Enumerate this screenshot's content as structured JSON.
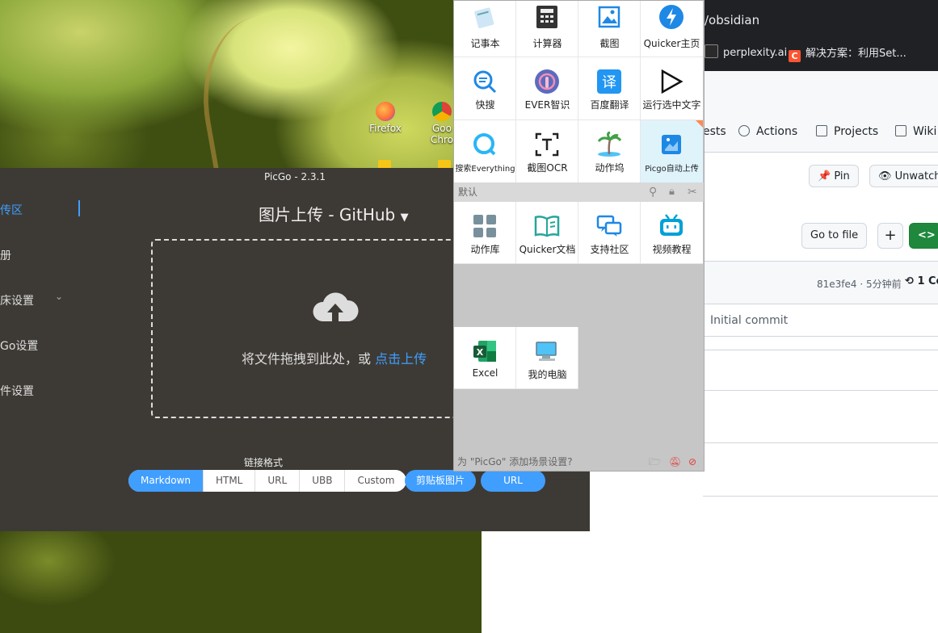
{
  "desktop": {
    "icons": [
      {
        "label": "Firefox",
        "color": "#ff7139"
      },
      {
        "label": "Goo\nChro",
        "label_line1": "Goo",
        "label_line2": "Chro",
        "color": "#4285f4"
      }
    ]
  },
  "browser": {
    "address_fragment": "/obsidian",
    "bookmarks": [
      {
        "label": "perplexity.ai",
        "icon": "perplexity-icon",
        "icon_text": "",
        "color": "#20808d"
      },
      {
        "label": "解决方案：利用Set...",
        "icon": "csdn-icon",
        "icon_text": "C",
        "color": "#fc5531"
      }
    ],
    "repo_tabs": [
      {
        "label": "ests",
        "icon": "pull-request-icon"
      },
      {
        "label": "Actions",
        "icon": "play-icon"
      },
      {
        "label": "Projects",
        "icon": "table-icon"
      },
      {
        "label": "Wiki",
        "icon": "book-icon"
      }
    ],
    "pin_label": "Pin",
    "unwatch_label": "Unwatch",
    "go_to_file_label": "Go to file",
    "add_label": "+",
    "code_label": "<>",
    "commit_meta": "81e3fe4 · 5分钟前",
    "commits_label": "1 Co",
    "commit_message": "Initial commit"
  },
  "picgo": {
    "window_title": "PicGo - 2.3.1",
    "sidebar": [
      {
        "label": "传区",
        "active": true
      },
      {
        "label": "册",
        "active": false
      },
      {
        "label": "床设置",
        "active": false,
        "has_chevron": true
      },
      {
        "label": "Go设置",
        "active": false
      },
      {
        "label": "件设置",
        "active": false
      }
    ],
    "upload_title": "图片上传 - GitHub",
    "drop_text": "将文件拖拽到此处，或 ",
    "drop_link": "点击上传",
    "format_label": "链接格式",
    "formats": [
      {
        "label": "Markdown",
        "active": true
      },
      {
        "label": "HTML",
        "active": false
      },
      {
        "label": "URL",
        "active": false
      },
      {
        "label": "UBB",
        "active": false
      },
      {
        "label": "Custom",
        "active": false
      }
    ],
    "clipboard_button": "剪贴板图片",
    "url_button": "URL",
    "accent_color": "#409eff"
  },
  "quicker": {
    "row1": [
      "记事本",
      "计算器",
      "截图",
      "Quicker主页"
    ],
    "row2": [
      "快搜",
      "EVER智识",
      "百度翻译",
      "运行选中文字"
    ],
    "row3": [
      "搜索Everything",
      "截图OCR",
      "动作坞",
      "Picgo自动上传"
    ],
    "section_label": "默认",
    "row4": [
      "动作库",
      "Quicker文档",
      "支持社区",
      "视频教程"
    ],
    "row5": [
      "Excel",
      "我的电脑"
    ],
    "footer_text": "为 \"PicGo\" 添加场景设置?"
  }
}
